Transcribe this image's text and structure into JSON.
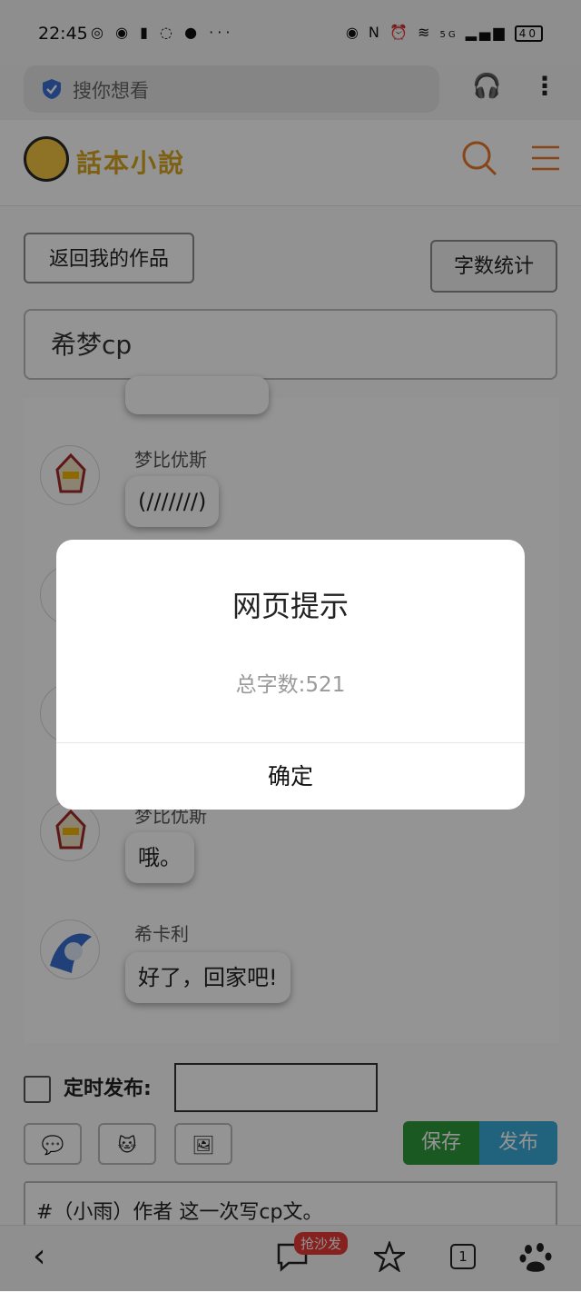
{
  "status_bar": {
    "time": "22:45",
    "left_icons": [
      "wechat-icon",
      "browser-app-icon",
      "sim-icon",
      "chat-bubble-icon",
      "message-icon"
    ],
    "more": "···",
    "network": "5G",
    "battery": "40"
  },
  "browser": {
    "search_placeholder": "搜你想看"
  },
  "site": {
    "logo_text": "話本小說"
  },
  "editor": {
    "back_button": "返回我的作品",
    "count_button": "字数统计",
    "title_value": "希梦cp",
    "messages": [
      {
        "name": "梦比优斯",
        "text": "(///////)"
      },
      {
        "name": "梦比优斯",
        "text": "哦。"
      },
      {
        "name": "希卡利",
        "text": "好了，回家吧!"
      }
    ],
    "schedule_label": "定时发布:",
    "save_button": "保存",
    "publish_button": "发布",
    "content_text": "#（小雨）作者 这一次写cp文。"
  },
  "bottom_nav": {
    "badge": "抢沙发",
    "tab_count": "1"
  },
  "dialog": {
    "title": "网页提示",
    "message": "总字数:521",
    "ok_button": "确定"
  }
}
